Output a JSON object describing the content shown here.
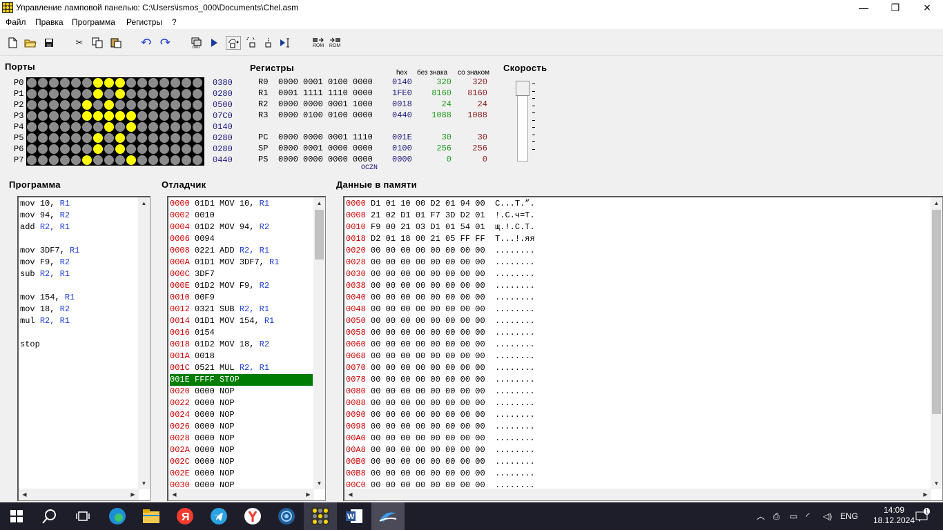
{
  "window": {
    "title": "Управление ламповой панелью: C:\\Users\\ismos_000\\Documents\\Chel.asm",
    "min": "—",
    "max": "❐",
    "close": "✕"
  },
  "menu": [
    "Файл",
    "Правка",
    "Программа",
    "Регистры",
    "?"
  ],
  "toolbar": {
    "rom1": "ROM",
    "rom2": "ROM",
    "icons": [
      "new-file-icon",
      "open-folder-icon",
      "save-icon",
      "cut-icon",
      "copy-icon",
      "paste-icon",
      "undo-icon",
      "redo-icon",
      "step-run-icon",
      "run-icon",
      "step-over-icon",
      "step-into-icon",
      "step-out-icon",
      "run-to-cursor-icon",
      "rom-load-icon",
      "rom-save-icon"
    ]
  },
  "ports": {
    "title": "Порты",
    "rows": [
      {
        "label": "P0",
        "value": "0380",
        "on": [
          6,
          7,
          8
        ]
      },
      {
        "label": "P1",
        "value": "0280",
        "on": [
          6,
          8
        ]
      },
      {
        "label": "P2",
        "value": "0500",
        "on": [
          5,
          7
        ]
      },
      {
        "label": "P3",
        "value": "07C0",
        "on": [
          5,
          6,
          7,
          8,
          9
        ]
      },
      {
        "label": "P4",
        "value": "0140",
        "on": [
          7,
          9
        ]
      },
      {
        "label": "P5",
        "value": "0280",
        "on": [
          6,
          8
        ]
      },
      {
        "label": "P6",
        "value": "0280",
        "on": [
          6,
          8
        ]
      },
      {
        "label": "P7",
        "value": "0440",
        "on": [
          5,
          9
        ]
      }
    ]
  },
  "registers": {
    "title": "Регистры",
    "hdr_hex": "hex",
    "hdr_unsigned": "без знака",
    "hdr_signed": "со знаком",
    "flags": "OCZN",
    "rows": [
      {
        "name": "R0",
        "bin": "0000 0001 0100 0000",
        "hex": "0140",
        "u": "320",
        "s": "320"
      },
      {
        "name": "R1",
        "bin": "0001 1111 1110 0000",
        "hex": "1FE0",
        "u": "8160",
        "s": "8160"
      },
      {
        "name": "R2",
        "bin": "0000 0000 0001 1000",
        "hex": "0018",
        "u": "24",
        "s": "24"
      },
      {
        "name": "R3",
        "bin": "0000 0100 0100 0000",
        "hex": "0440",
        "u": "1088",
        "s": "1088"
      },
      {
        "name": "PC",
        "bin": "0000 0000 0001 1110",
        "hex": "001E",
        "u": "30",
        "s": "30"
      },
      {
        "name": "SP",
        "bin": "0000 0001 0000 0000",
        "hex": "0100",
        "u": "256",
        "s": "256"
      },
      {
        "name": "PS",
        "bin": "0000 0000 0000 0000",
        "hex": "0000",
        "u": "0",
        "s": "0"
      }
    ]
  },
  "speed": {
    "title": "Скорость"
  },
  "program": {
    "title": "Программа",
    "lines": [
      {
        "op": "mov",
        "a": "10,",
        "r": "R1"
      },
      {
        "op": "mov",
        "a": "94,",
        "r": "R2"
      },
      {
        "op": "add",
        "a": "R2,",
        "r": "R1",
        "areg": true
      },
      {
        "op": "",
        "a": "",
        "r": ""
      },
      {
        "op": "mov",
        "a": "3DF7,",
        "r": "R1"
      },
      {
        "op": "mov",
        "a": "F9,",
        "r": "R2"
      },
      {
        "op": "sub",
        "a": "R2,",
        "r": "R1",
        "areg": true
      },
      {
        "op": "",
        "a": "",
        "r": ""
      },
      {
        "op": "mov",
        "a": "154,",
        "r": "R1"
      },
      {
        "op": "mov",
        "a": "18,",
        "r": "R2"
      },
      {
        "op": "mul",
        "a": "R2,",
        "r": "R1",
        "areg": true
      },
      {
        "op": "",
        "a": "",
        "r": ""
      },
      {
        "op": "stop",
        "a": "",
        "r": ""
      }
    ]
  },
  "debugger": {
    "title": "Отладчик",
    "highlight_index": 15,
    "lines": [
      {
        "addr": "0000",
        "code": "01D1",
        "instr": "MOV 10,",
        "reg": "R1"
      },
      {
        "addr": "0002",
        "code": "0010",
        "instr": "",
        "reg": ""
      },
      {
        "addr": "0004",
        "code": "01D2",
        "instr": "MOV 94,",
        "reg": "R2"
      },
      {
        "addr": "0006",
        "code": "0094",
        "instr": "",
        "reg": ""
      },
      {
        "addr": "0008",
        "code": "0221",
        "instr": "ADD",
        "reg": "R2, R1"
      },
      {
        "addr": "000A",
        "code": "01D1",
        "instr": "MOV 3DF7,",
        "reg": "R1"
      },
      {
        "addr": "000C",
        "code": "3DF7",
        "instr": "",
        "reg": ""
      },
      {
        "addr": "000E",
        "code": "01D2",
        "instr": "MOV F9,",
        "reg": "R2"
      },
      {
        "addr": "0010",
        "code": "00F9",
        "instr": "",
        "reg": ""
      },
      {
        "addr": "0012",
        "code": "0321",
        "instr": "SUB",
        "reg": "R2, R1"
      },
      {
        "addr": "0014",
        "code": "01D1",
        "instr": "MOV 154,",
        "reg": "R1"
      },
      {
        "addr": "0016",
        "code": "0154",
        "instr": "",
        "reg": ""
      },
      {
        "addr": "0018",
        "code": "01D2",
        "instr": "MOV 18,",
        "reg": "R2"
      },
      {
        "addr": "001A",
        "code": "0018",
        "instr": "",
        "reg": ""
      },
      {
        "addr": "001C",
        "code": "0521",
        "instr": "MUL",
        "reg": "R2, R1"
      },
      {
        "addr": "001E",
        "code": "FFFF",
        "instr": "STOP",
        "reg": ""
      },
      {
        "addr": "0020",
        "code": "0000",
        "instr": "NOP",
        "reg": ""
      },
      {
        "addr": "0022",
        "code": "0000",
        "instr": "NOP",
        "reg": ""
      },
      {
        "addr": "0024",
        "code": "0000",
        "instr": "NOP",
        "reg": ""
      },
      {
        "addr": "0026",
        "code": "0000",
        "instr": "NOP",
        "reg": ""
      },
      {
        "addr": "0028",
        "code": "0000",
        "instr": "NOP",
        "reg": ""
      },
      {
        "addr": "002A",
        "code": "0000",
        "instr": "NOP",
        "reg": ""
      },
      {
        "addr": "002C",
        "code": "0000",
        "instr": "NOP",
        "reg": ""
      },
      {
        "addr": "002E",
        "code": "0000",
        "instr": "NOP",
        "reg": ""
      },
      {
        "addr": "0030",
        "code": "0000",
        "instr": "NOP",
        "reg": ""
      }
    ]
  },
  "memory": {
    "title": "Данные в памяти",
    "lines": [
      {
        "addr": "0000",
        "bytes": "D1 01 10 00 D2 01 94 00",
        "ascii": "С...Т.”."
      },
      {
        "addr": "0008",
        "bytes": "21 02 D1 01 F7 3D D2 01",
        "ascii": "!.С.ч=Т."
      },
      {
        "addr": "0010",
        "bytes": "F9 00 21 03 D1 01 54 01",
        "ascii": "щ.!.С.Т."
      },
      {
        "addr": "0018",
        "bytes": "D2 01 18 00 21 05 FF FF",
        "ascii": "Т...!.яя"
      },
      {
        "addr": "0020",
        "bytes": "00 00 00 00 00 00 00 00",
        "ascii": "........"
      },
      {
        "addr": "0028",
        "bytes": "00 00 00 00 00 00 00 00",
        "ascii": "........"
      },
      {
        "addr": "0030",
        "bytes": "00 00 00 00 00 00 00 00",
        "ascii": "........"
      },
      {
        "addr": "0038",
        "bytes": "00 00 00 00 00 00 00 00",
        "ascii": "........"
      },
      {
        "addr": "0040",
        "bytes": "00 00 00 00 00 00 00 00",
        "ascii": "........"
      },
      {
        "addr": "0048",
        "bytes": "00 00 00 00 00 00 00 00",
        "ascii": "........"
      },
      {
        "addr": "0050",
        "bytes": "00 00 00 00 00 00 00 00",
        "ascii": "........"
      },
      {
        "addr": "0058",
        "bytes": "00 00 00 00 00 00 00 00",
        "ascii": "........"
      },
      {
        "addr": "0060",
        "bytes": "00 00 00 00 00 00 00 00",
        "ascii": "........"
      },
      {
        "addr": "0068",
        "bytes": "00 00 00 00 00 00 00 00",
        "ascii": "........"
      },
      {
        "addr": "0070",
        "bytes": "00 00 00 00 00 00 00 00",
        "ascii": "........"
      },
      {
        "addr": "0078",
        "bytes": "00 00 00 00 00 00 00 00",
        "ascii": "........"
      },
      {
        "addr": "0080",
        "bytes": "00 00 00 00 00 00 00 00",
        "ascii": "........"
      },
      {
        "addr": "0088",
        "bytes": "00 00 00 00 00 00 00 00",
        "ascii": "........"
      },
      {
        "addr": "0090",
        "bytes": "00 00 00 00 00 00 00 00",
        "ascii": "........"
      },
      {
        "addr": "0098",
        "bytes": "00 00 00 00 00 00 00 00",
        "ascii": "........"
      },
      {
        "addr": "00A0",
        "bytes": "00 00 00 00 00 00 00 00",
        "ascii": "........"
      },
      {
        "addr": "00A8",
        "bytes": "00 00 00 00 00 00 00 00",
        "ascii": "........"
      },
      {
        "addr": "00B0",
        "bytes": "00 00 00 00 00 00 00 00",
        "ascii": "........"
      },
      {
        "addr": "00B8",
        "bytes": "00 00 00 00 00 00 00 00",
        "ascii": "........"
      },
      {
        "addr": "00C0",
        "bytes": "00 00 00 00 00 00 00 00",
        "ascii": "........"
      }
    ]
  },
  "taskbar": {
    "lang": "ENG",
    "time": "14:09",
    "date": "18.12.2024",
    "notif": "1"
  },
  "colors": {
    "green": "#1e9a1e",
    "darkred": "#8b1a1a",
    "navy": "#1a1a80",
    "red": "#cc0000",
    "blue": "#1f3fd6",
    "highlight": "#007c00"
  }
}
